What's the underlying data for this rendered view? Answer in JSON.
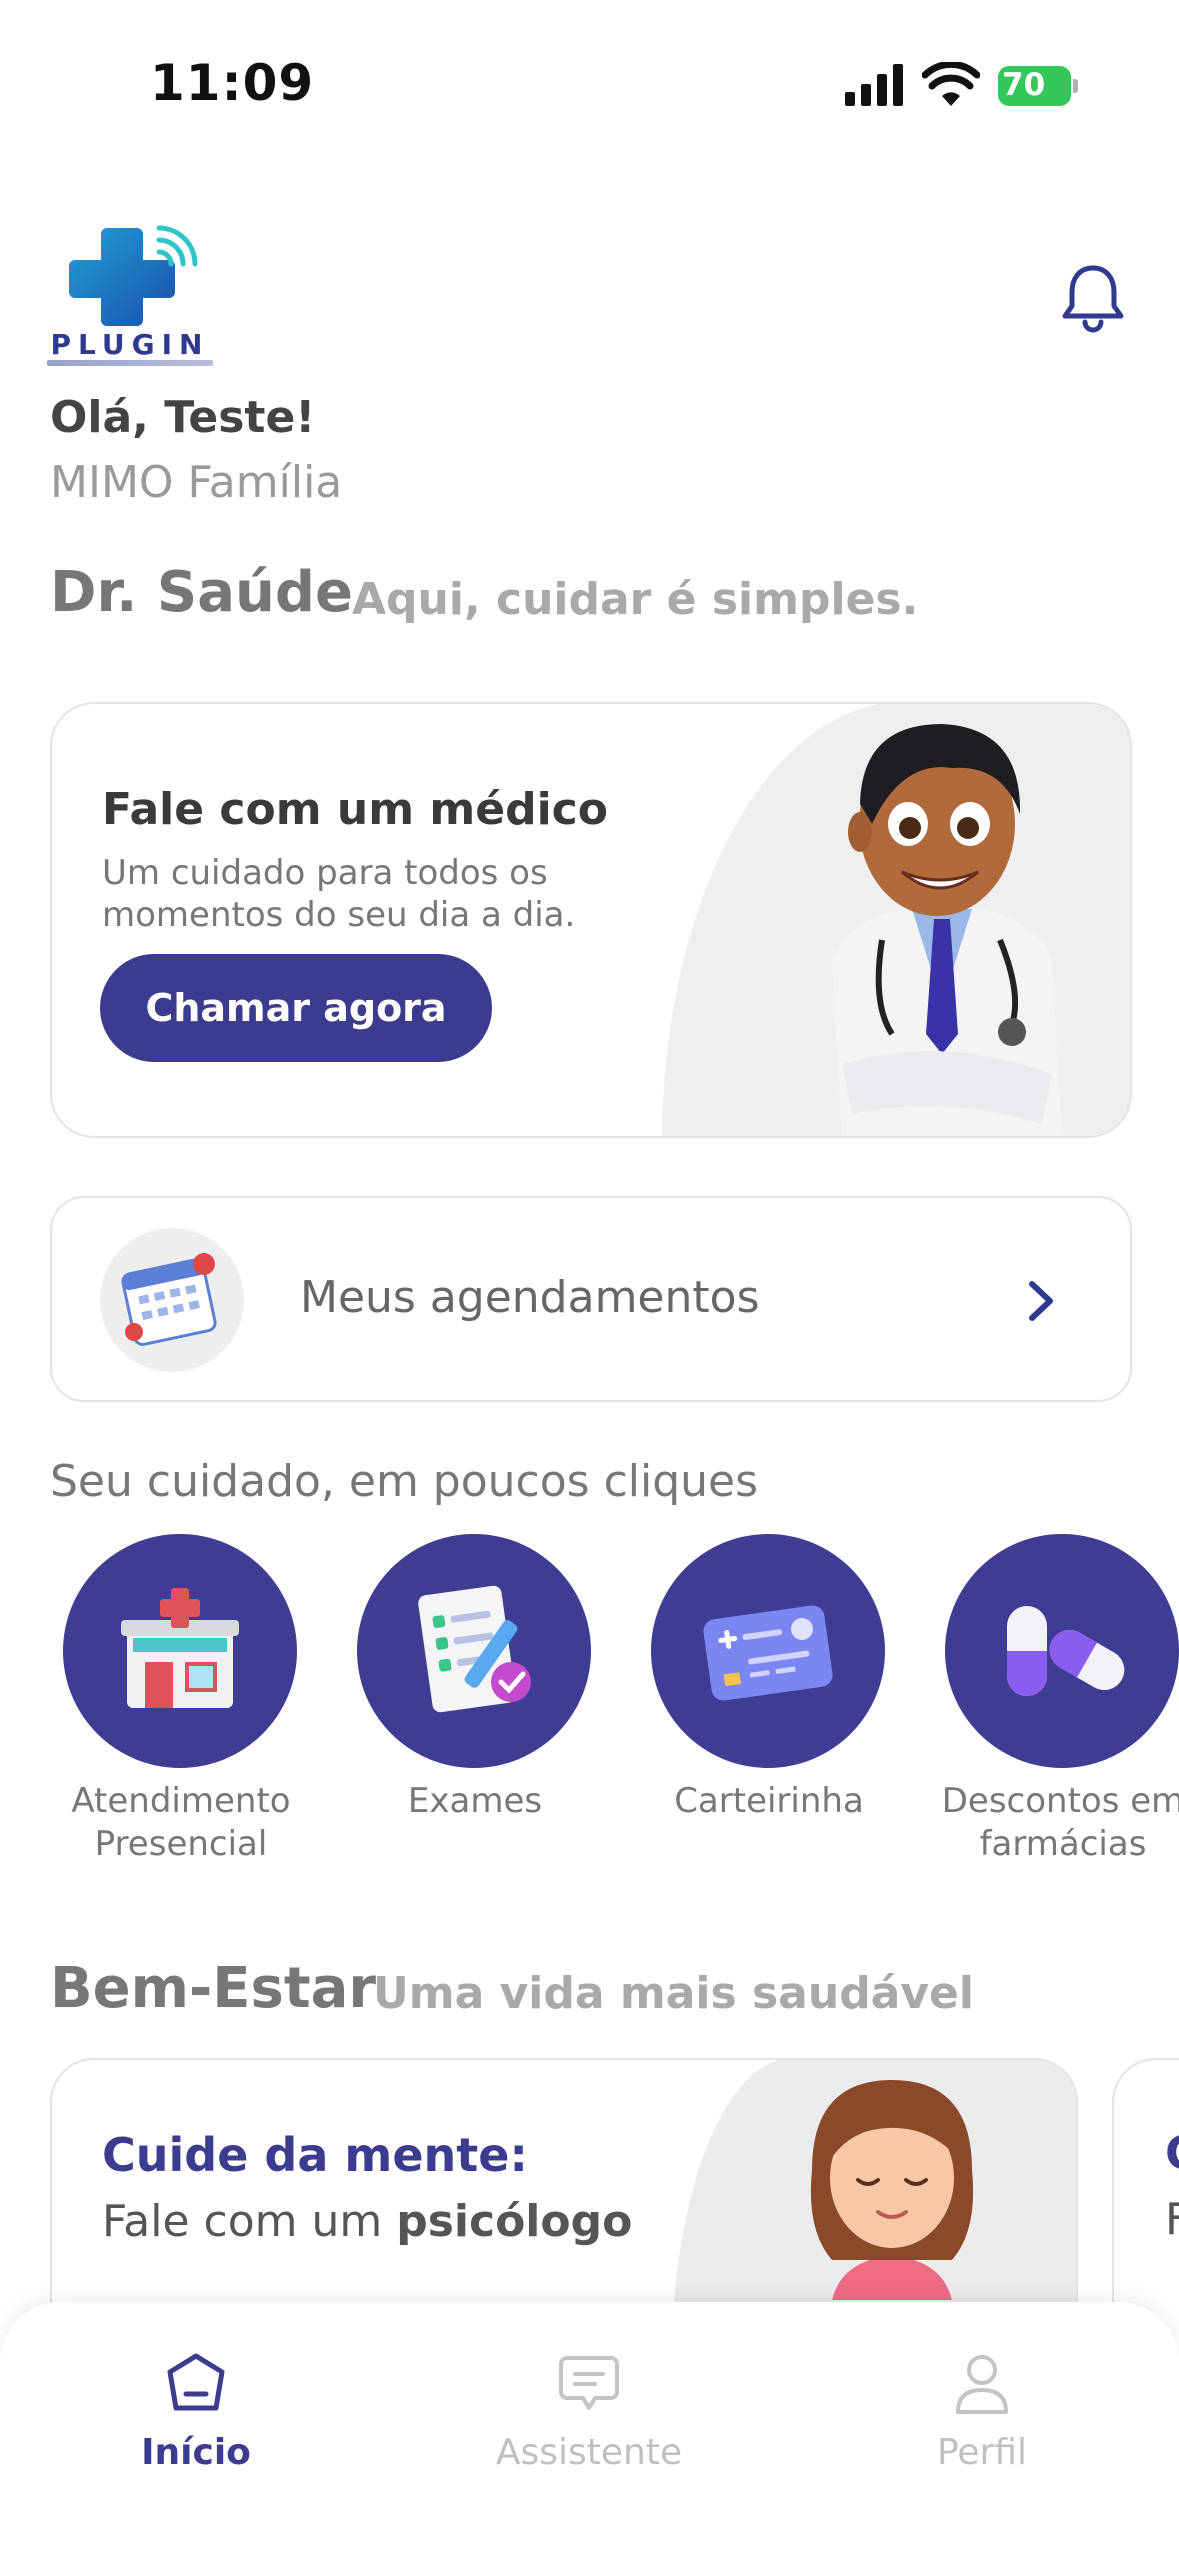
{
  "status_bar": {
    "time": "11:09",
    "battery": "70"
  },
  "header": {
    "logo_text": "PLUGIN",
    "greeting": "Olá, Teste!",
    "plan_name": "MIMO Família"
  },
  "brand_section": {
    "title": "Dr. Saúde",
    "subtitle": "Aqui, cuidar é simples."
  },
  "doctor_card": {
    "heading": "Fale com um médico",
    "description": "Um cuidado para todos os momentos do seu dia a dia.",
    "button_label": "Chamar agora"
  },
  "appointments": {
    "label": "Meus agendamentos"
  },
  "quick_access": {
    "title": "Seu cuidado, em poucos cliques",
    "items": [
      {
        "label": "Atendimento Presencial",
        "icon": "clinic-icon"
      },
      {
        "label": "Exames",
        "icon": "exam-icon"
      },
      {
        "label": "Carteirinha",
        "icon": "card-icon"
      },
      {
        "label": "Descontos em farmácias",
        "icon": "pill-icon"
      }
    ]
  },
  "wellness_section": {
    "title": "Bem-Estar",
    "subtitle": "Uma vida mais saudável",
    "card_heading": "Cuide da mente:",
    "card_sub_prefix": "Fale com um ",
    "card_sub_bold": "psicólogo",
    "next_card_heading_start": "C",
    "next_card_sub_start": "F"
  },
  "tab_bar": {
    "tabs": [
      {
        "label": "Início",
        "icon": "home-icon",
        "active": true
      },
      {
        "label": "Assistente",
        "icon": "chat-icon",
        "active": false
      },
      {
        "label": "Perfil",
        "icon": "user-icon",
        "active": false
      }
    ]
  },
  "colors": {
    "primary": "#3b3c8f",
    "battery_green": "#34c759",
    "card_border": "#e3e3ea"
  }
}
